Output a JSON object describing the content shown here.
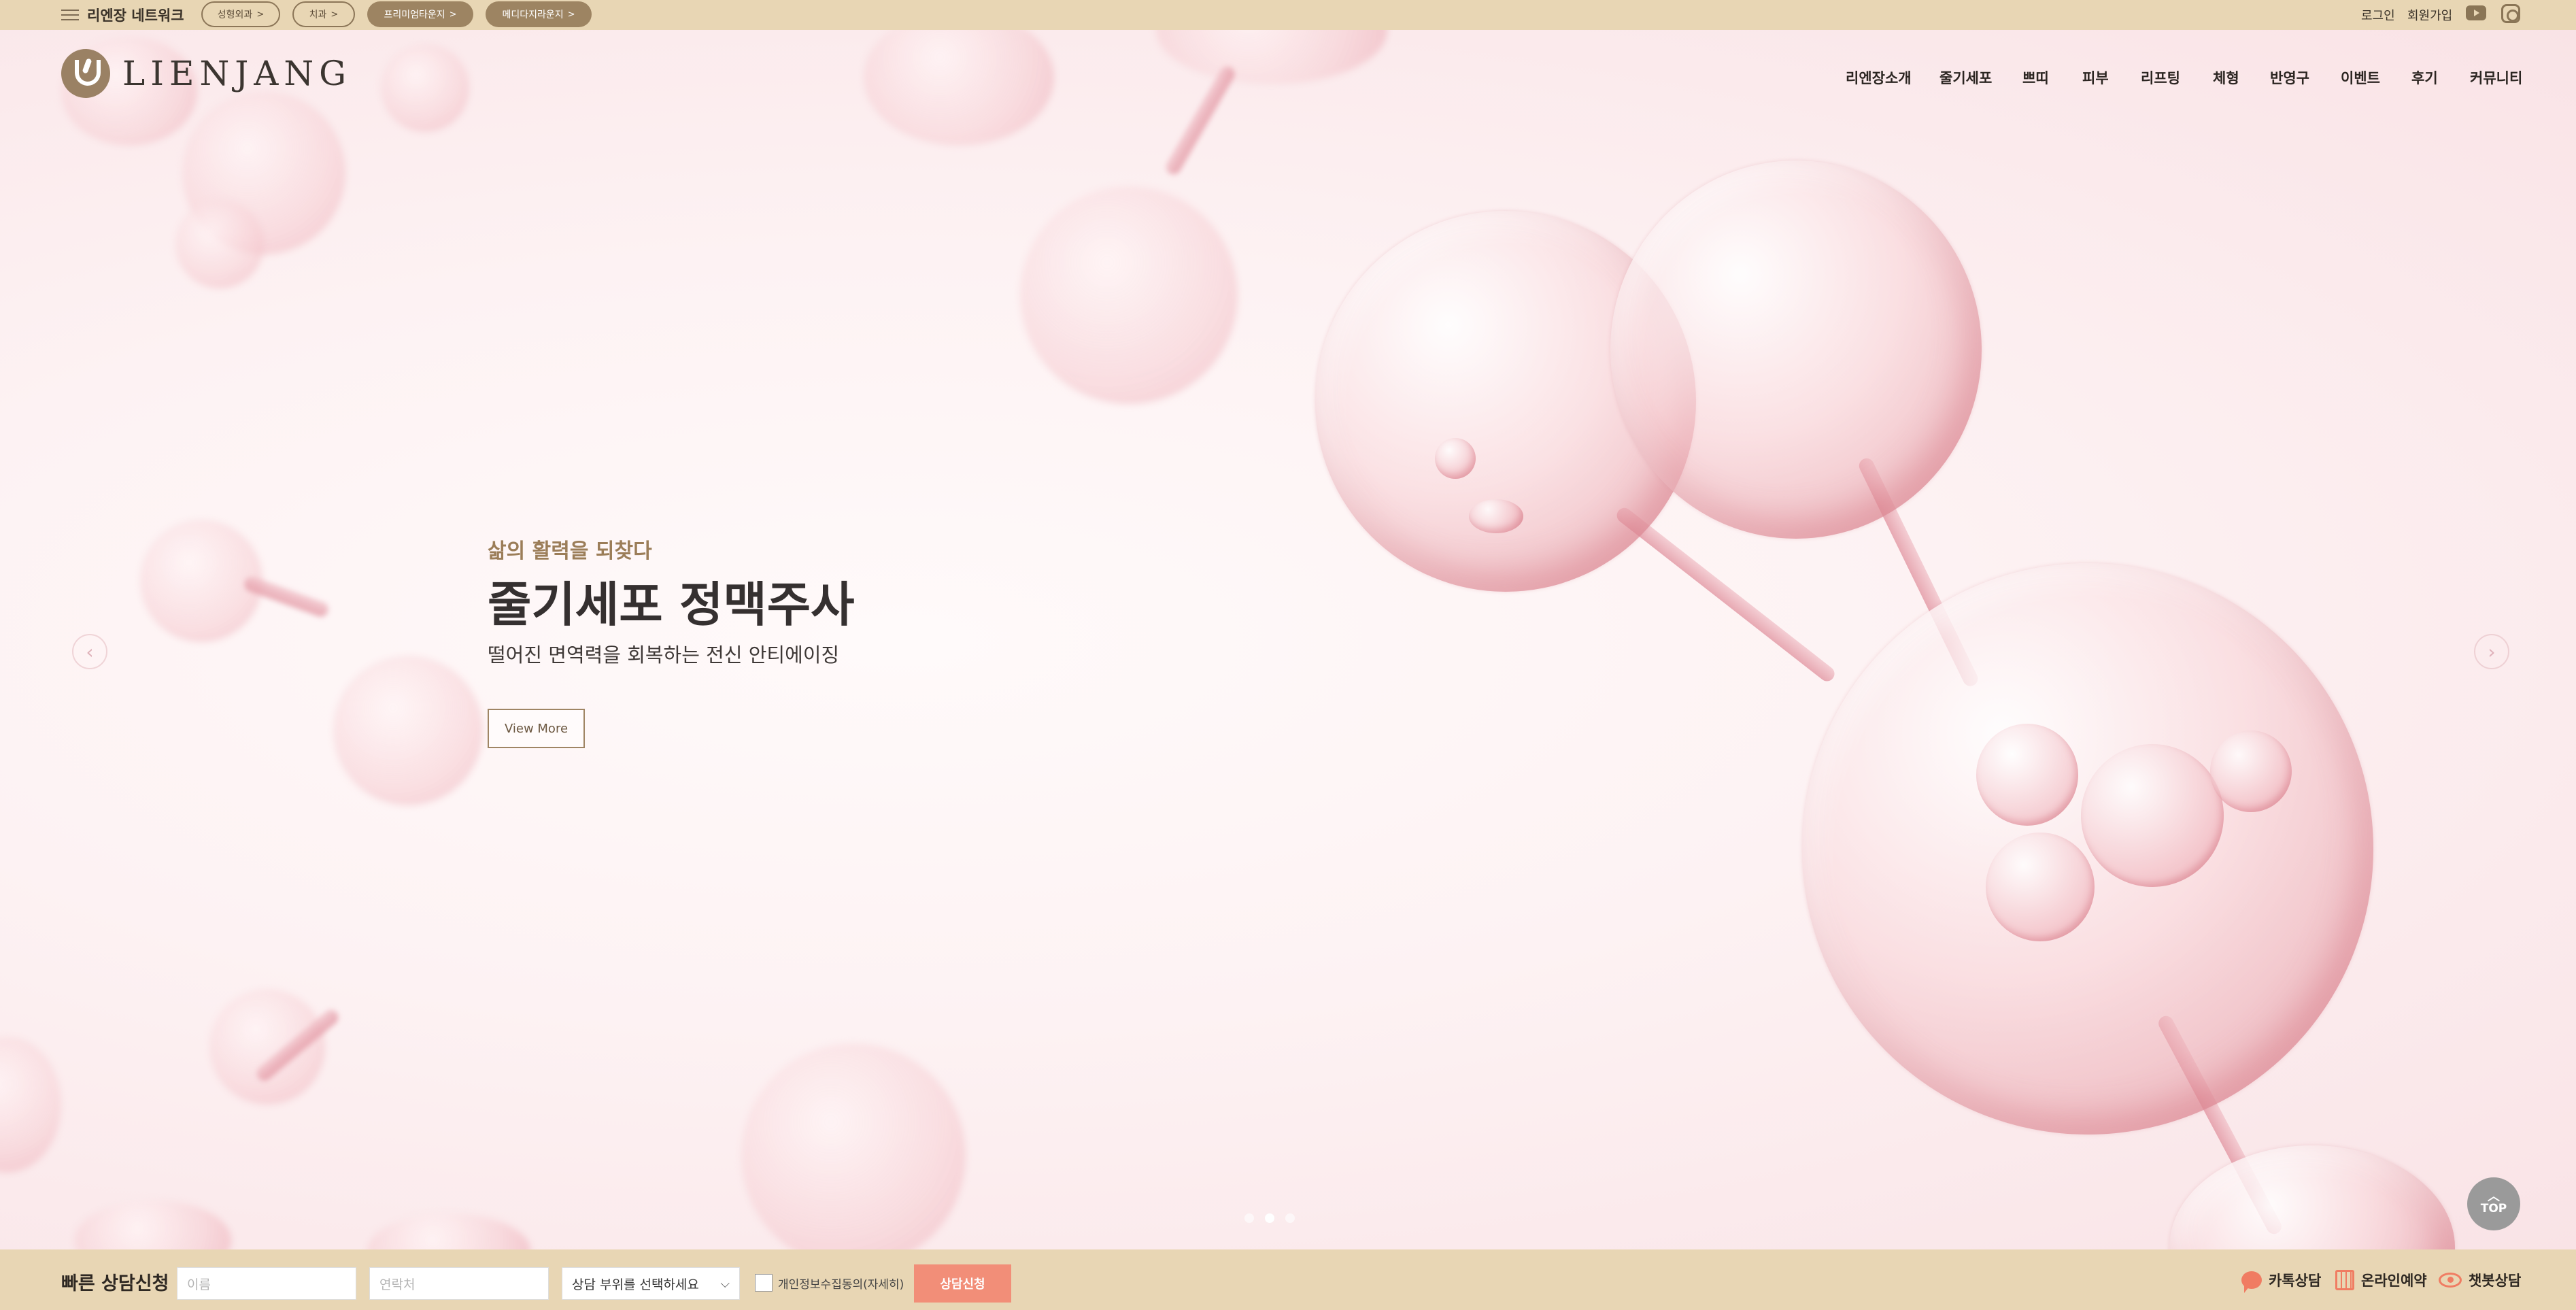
{
  "topbar": {
    "network_label": "리엔장 네트워크",
    "pills": [
      {
        "label": "성형외과",
        "chevron": ">"
      },
      {
        "label": "치과",
        "chevron": ">"
      },
      {
        "label": "프리미엄타운지",
        "chevron": ">"
      },
      {
        "label": "메디다지라운지",
        "chevron": ">"
      }
    ],
    "login": "로그인",
    "signup": "회원가입"
  },
  "header": {
    "logo_text": "LIENJANG",
    "nav": [
      "리엔장소개",
      "줄기세포",
      "쁘띠",
      "피부",
      "리프팅",
      "체형",
      "반영구",
      "이벤트",
      "후기",
      "커뮤니티"
    ]
  },
  "hero": {
    "subtitle": "삶의 활력을 되찾다",
    "title": "줄기세포 정맥주사",
    "description": "떨어진 면역력을 회복하는 전신 안티에이징",
    "cta": "View More",
    "prev_arrow": "‹",
    "next_arrow": "›",
    "slide_count": 3,
    "active_slide": 2
  },
  "top_button": {
    "label": "TOP",
    "arrow": "︿"
  },
  "quick": {
    "title": "빠른 상담신청",
    "name_placeholder": "이름",
    "phone_placeholder": "연락처",
    "select_value": "상담 부위를 선택하세요",
    "select_chevron": "⌵",
    "agree_label": "개인정보수집동의(자세히)",
    "submit": "상담신청",
    "links": {
      "kakao": "카톡상담",
      "reserve": "온라인예약",
      "chatbot": "챗봇상담"
    }
  },
  "colors": {
    "beige_bar": "#e8d6b4",
    "brand_brown": "#9b7d58",
    "accent_coral": "#f28e78",
    "hero_pink": "#f6d9dc"
  }
}
